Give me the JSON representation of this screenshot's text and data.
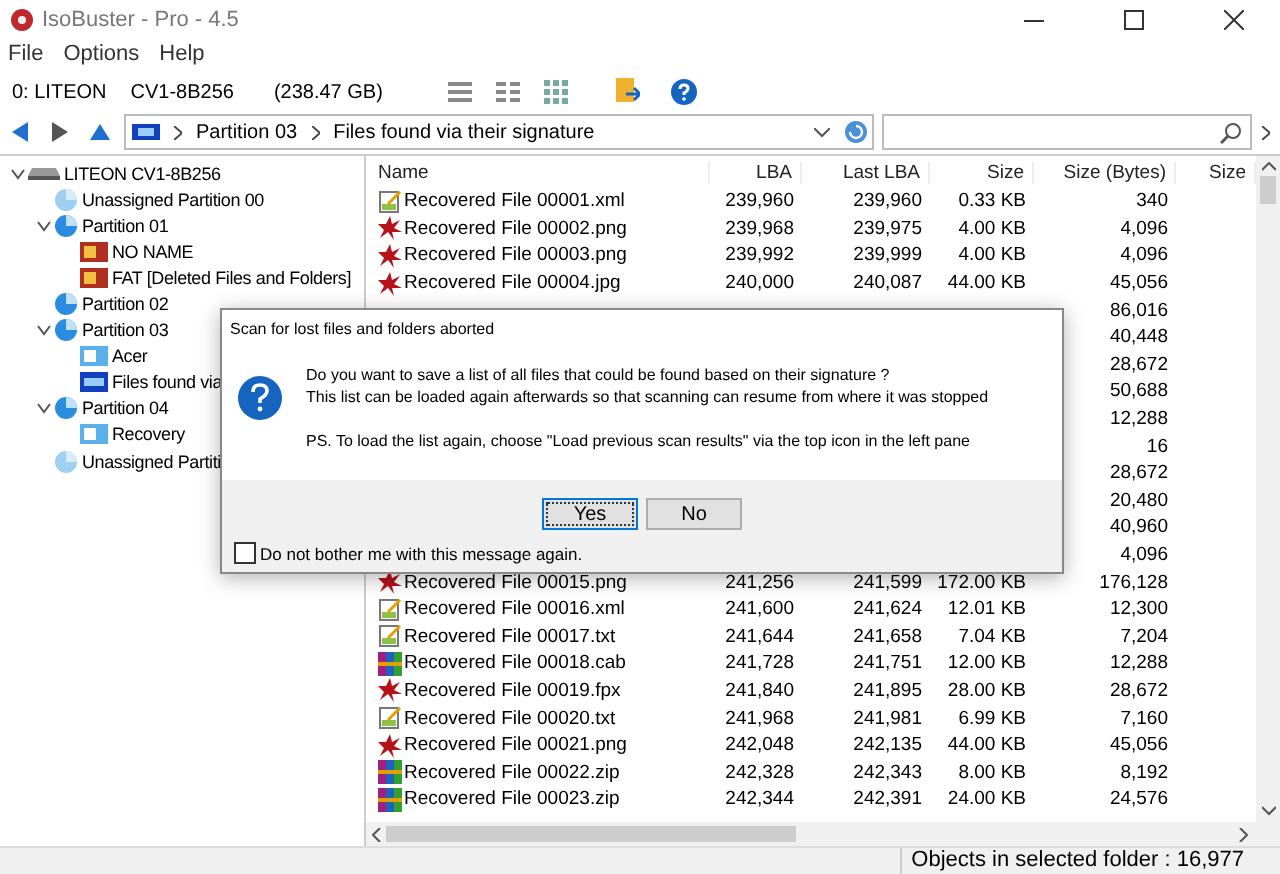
{
  "window": {
    "title": "IsoBuster - Pro - 4.5"
  },
  "menu": [
    "File",
    "Options",
    "Help"
  ],
  "toolbar": {
    "drive": {
      "id": "0: LITEON",
      "model": "CV1-8B256",
      "capacity": "(238.47 GB)"
    }
  },
  "address": {
    "crumbs": [
      "Partition 03",
      "Files found via their signature"
    ]
  },
  "tree": [
    {
      "label": "LITEON CV1-8B256",
      "kind": "drive",
      "expanded": true,
      "children": [
        {
          "label": "Unassigned Partition 00",
          "kind": "unassigned"
        },
        {
          "label": "Partition 01",
          "kind": "partition",
          "expanded": true,
          "children": [
            {
              "label": "NO NAME",
              "kind": "fat"
            },
            {
              "label": "FAT [Deleted Files and Folders]",
              "kind": "fat"
            }
          ]
        },
        {
          "label": "Partition 02",
          "kind": "partition"
        },
        {
          "label": "Partition 03",
          "kind": "partition",
          "expanded": true,
          "children": [
            {
              "label": "Acer",
              "kind": "ntfs"
            },
            {
              "label": "Files found via",
              "kind": "signature"
            }
          ]
        },
        {
          "label": "Partition 04",
          "kind": "partition",
          "expanded": true,
          "children": [
            {
              "label": "Recovery",
              "kind": "ntfs"
            }
          ]
        },
        {
          "label": "Unassigned Partiti",
          "kind": "unassigned"
        }
      ]
    }
  ],
  "table": {
    "columns": [
      "Name",
      "LBA",
      "Last LBA",
      "Size",
      "Size (Bytes)",
      "Size"
    ],
    "rows": [
      {
        "kind": "text",
        "name": "Recovered File 00001.xml",
        "lba": "239,960",
        "last_lba": "239,960",
        "size": "0.33 KB",
        "bytes": "340"
      },
      {
        "kind": "image",
        "name": "Recovered File 00002.png",
        "lba": "239,968",
        "last_lba": "239,975",
        "size": "4.00 KB",
        "bytes": "4,096"
      },
      {
        "kind": "image",
        "name": "Recovered File 00003.png",
        "lba": "239,992",
        "last_lba": "239,999",
        "size": "4.00 KB",
        "bytes": "4,096"
      },
      {
        "kind": "image",
        "name": "Recovered File 00004.jpg",
        "lba": "240,000",
        "last_lba": "240,087",
        "size": "44.00 KB",
        "bytes": "45,056"
      },
      {
        "kind": "hidden",
        "bytes": "86,016"
      },
      {
        "kind": "hidden",
        "bytes": "40,448"
      },
      {
        "kind": "hidden",
        "bytes": "28,672"
      },
      {
        "kind": "hidden",
        "bytes": "50,688"
      },
      {
        "kind": "hidden",
        "bytes": "12,288"
      },
      {
        "kind": "hidden",
        "bytes": "16"
      },
      {
        "kind": "hidden",
        "bytes": "28,672"
      },
      {
        "kind": "hidden",
        "bytes": "20,480"
      },
      {
        "kind": "hidden",
        "bytes": "40,960"
      },
      {
        "kind": "hidden",
        "bytes": "4,096"
      },
      {
        "kind": "image",
        "name": "Recovered File 00015.png",
        "lba": "241,256",
        "last_lba": "241,599",
        "size": "172.00 KB",
        "bytes": "176,128"
      },
      {
        "kind": "text",
        "name": "Recovered File 00016.xml",
        "lba": "241,600",
        "last_lba": "241,624",
        "size": "12.01 KB",
        "bytes": "12,300"
      },
      {
        "kind": "text",
        "name": "Recovered File 00017.txt",
        "lba": "241,644",
        "last_lba": "241,658",
        "size": "7.04 KB",
        "bytes": "7,204"
      },
      {
        "kind": "archive",
        "name": "Recovered File 00018.cab",
        "lba": "241,728",
        "last_lba": "241,751",
        "size": "12.00 KB",
        "bytes": "12,288"
      },
      {
        "kind": "image",
        "name": "Recovered File 00019.fpx",
        "lba": "241,840",
        "last_lba": "241,895",
        "size": "28.00 KB",
        "bytes": "28,672"
      },
      {
        "kind": "text",
        "name": "Recovered File 00020.txt",
        "lba": "241,968",
        "last_lba": "241,981",
        "size": "6.99 KB",
        "bytes": "7,160"
      },
      {
        "kind": "image",
        "name": "Recovered File 00021.png",
        "lba": "242,048",
        "last_lba": "242,135",
        "size": "44.00 KB",
        "bytes": "45,056"
      },
      {
        "kind": "archive",
        "name": "Recovered File 00022.zip",
        "lba": "242,328",
        "last_lba": "242,343",
        "size": "8.00 KB",
        "bytes": "8,192"
      },
      {
        "kind": "archive",
        "name": "Recovered File 00023.zip",
        "lba": "242,344",
        "last_lba": "242,391",
        "size": "24.00 KB",
        "bytes": "24,576"
      }
    ]
  },
  "status_bar": {
    "objects": "Objects in selected folder : 16,977"
  },
  "dialog": {
    "title": "Scan for lost files and folders aborted",
    "lines": [
      "Do you want to save a list of all files that could be found based on their signature ?",
      "This list can be loaded again afterwards so that scanning can resume from where it was stopped",
      "PS. To load the list again, choose \"Load previous scan results\" via the top icon in the left pane"
    ],
    "buttons": [
      {
        "label": "Yes",
        "kind": "default"
      },
      {
        "label": "No",
        "kind": "normal"
      }
    ],
    "checkbox": {
      "label": "Do not bother me with this message again.",
      "checked": false
    }
  }
}
